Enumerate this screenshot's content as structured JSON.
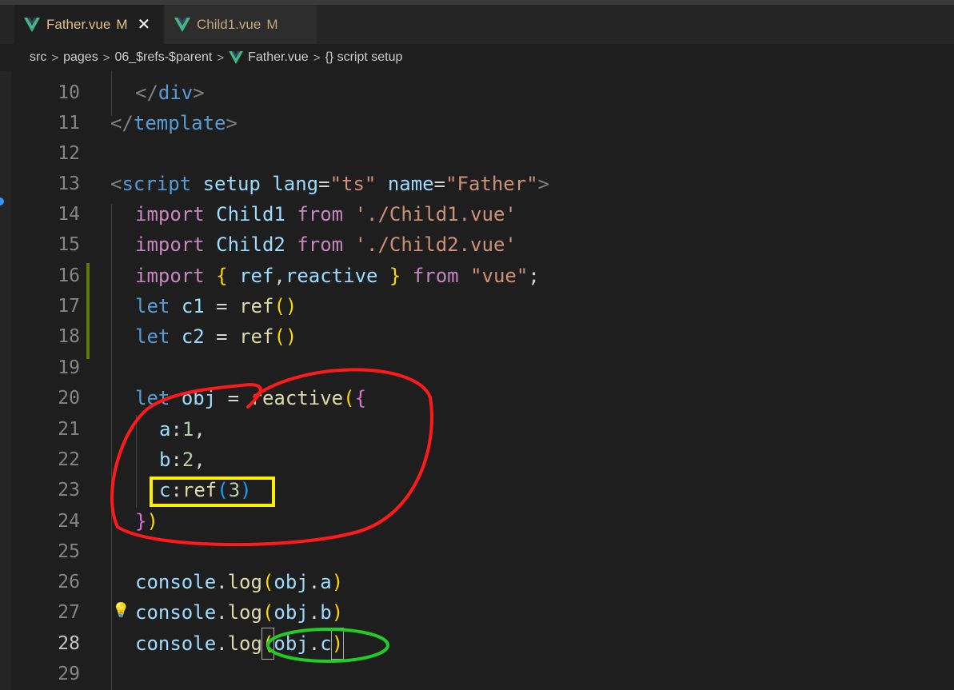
{
  "tabs": [
    {
      "label": "Father.vue",
      "modified": "M",
      "close": "✕"
    },
    {
      "label": "Child1.vue",
      "modified": "M"
    }
  ],
  "breadcrumb": [
    "src",
    "pages",
    "06_$refs-$parent",
    "Father.vue",
    "{} script setup"
  ],
  "code": {
    "lines": {
      "l10": "10",
      "l11": "11",
      "l12": "12",
      "l13": "13",
      "l14": "14",
      "l15": "15",
      "l16": "16",
      "l17": "17",
      "l18": "18",
      "l19": "19",
      "l20": "20",
      "l21": "21",
      "l22": "22",
      "l23": "23",
      "l24": "24",
      "l25": "25",
      "l26": "26",
      "l27": "27",
      "l28": "28",
      "l29": "29"
    },
    "t10": {
      "open": "</",
      "tag": "div",
      "close": ">"
    },
    "t11": {
      "open": "</",
      "tag": "template",
      "close": ">"
    },
    "t13": {
      "open": "<",
      "tag": "script",
      "a1": "setup",
      "a2": "lang",
      "eq": "=",
      "v2": "\"ts\"",
      "a3": "name",
      "v3": "\"Father\"",
      "close": ">"
    },
    "t14": {
      "kw": "import",
      "id": "Child1",
      "from": "from",
      "str": "'./Child1.vue'"
    },
    "t15": {
      "kw": "import",
      "id": "Child2",
      "from": "from",
      "str": "'./Child2.vue'"
    },
    "t16": {
      "kw": "import",
      "ob": "{",
      "id1": "ref",
      "comma": ",",
      "id2": "reactive",
      "cb": "}",
      "from": "from",
      "str": "\"vue\"",
      "semi": ";"
    },
    "t17": {
      "kw": "let",
      "id": "c1",
      "eq": "=",
      "fn": "ref",
      "pr": "()"
    },
    "t18": {
      "kw": "let",
      "id": "c2",
      "eq": "=",
      "fn": "ref",
      "pr": "()"
    },
    "t20": {
      "kw": "let",
      "id": "obj",
      "eq": "=",
      "fn": "reactive",
      "p": "(",
      "b": "{"
    },
    "t21": {
      "key": "a",
      "colon": ":",
      "num": "1",
      "comma": ","
    },
    "t22": {
      "key": "b",
      "colon": ":",
      "num": "2",
      "comma": ","
    },
    "t23": {
      "key": "c",
      "colon": ":",
      "fn": "ref",
      "p1": "(",
      "num": "3",
      "p2": ")"
    },
    "t24": {
      "b": "}",
      "p": ")"
    },
    "t26": {
      "id": "console",
      "dot": ".",
      "fn": "log",
      "p1": "(",
      "obj": "obj",
      "dot2": ".",
      "prop": "a",
      "p2": ")"
    },
    "t27": {
      "id": "console",
      "dot": ".",
      "fn": "log",
      "p1": "(",
      "obj": "obj",
      "dot2": ".",
      "prop": "b",
      "p2": ")"
    },
    "t28": {
      "id": "console",
      "dot": ".",
      "fn": "log",
      "p1": "(",
      "obj": "obj",
      "dot2": ".",
      "prop": "c",
      "p2": ")"
    }
  },
  "icons": {
    "lightbulb": "💡"
  },
  "colors": {
    "annotation_red": "#ff1a1a",
    "annotation_yellow": "#ffee00",
    "annotation_green": "#22cc22"
  }
}
